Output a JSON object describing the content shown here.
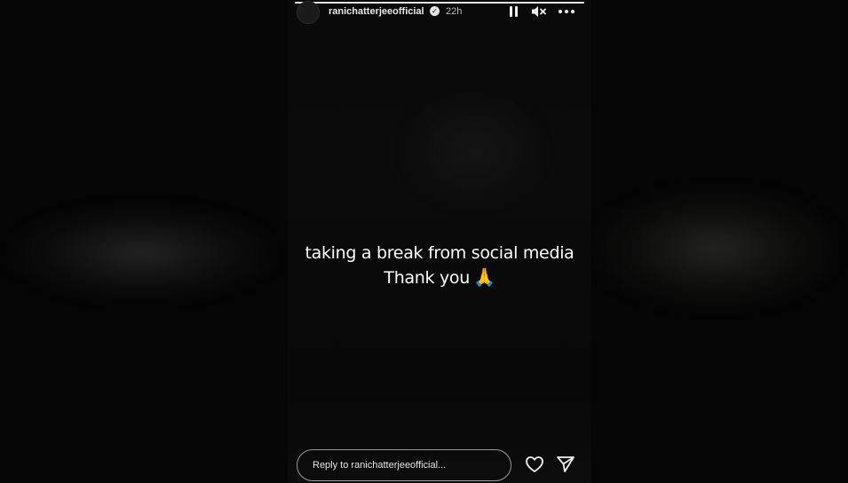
{
  "story": {
    "username": "ranichatterjeeofficial",
    "verified": true,
    "time_ago": "22h",
    "progress_fraction": 1.0,
    "message_line1": "taking a break from social media",
    "message_line2": "Thank you",
    "emoji": "🙏",
    "controls": {
      "pause_icon": "pause-icon",
      "mute_icon": "speaker-muted-icon",
      "more_icon": "more-horizontal-icon"
    }
  },
  "reply": {
    "placeholder": "Reply to ranichatterjeeofficial...",
    "like_icon": "heart-icon",
    "share_icon": "send-icon"
  },
  "colors": {
    "background": "#000000",
    "text": "#ffffff",
    "reply_border": "#9a9a9a"
  }
}
